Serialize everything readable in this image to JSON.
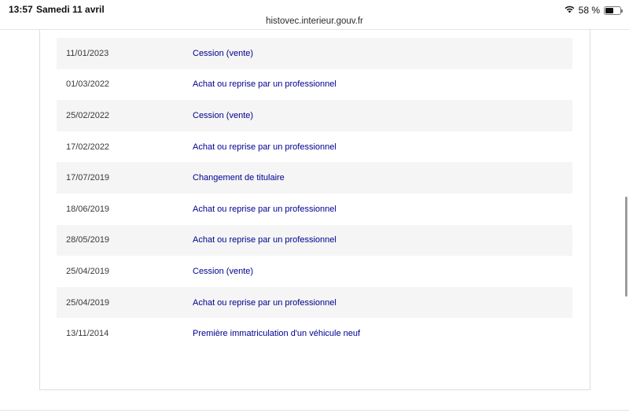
{
  "status_bar": {
    "time": "13:57",
    "date": "Samedi 11 avril",
    "battery_percent": "58 %",
    "battery_level": 0.58,
    "icons": [
      "wifi-icon",
      "battery-icon"
    ]
  },
  "browser": {
    "url": "histovec.interieur.gouv.fr"
  },
  "colors": {
    "link": "#000091",
    "row_shaded": "#f5f5f5"
  },
  "history": {
    "rows": [
      {
        "date": "11/01/2023",
        "event": "Cession (vente)"
      },
      {
        "date": "01/03/2022",
        "event": "Achat ou reprise par un professionnel"
      },
      {
        "date": "25/02/2022",
        "event": "Cession (vente)"
      },
      {
        "date": "17/02/2022",
        "event": "Achat ou reprise par un professionnel"
      },
      {
        "date": "17/07/2019",
        "event": "Changement de titulaire"
      },
      {
        "date": "18/06/2019",
        "event": "Achat ou reprise par un professionnel"
      },
      {
        "date": "28/05/2019",
        "event": "Achat ou reprise par un professionnel"
      },
      {
        "date": "25/04/2019",
        "event": "Cession (vente)"
      },
      {
        "date": "25/04/2019",
        "event": "Achat ou reprise par un professionnel"
      },
      {
        "date": "13/11/2014",
        "event": "Première immatriculation d'un véhicule neuf"
      }
    ]
  }
}
